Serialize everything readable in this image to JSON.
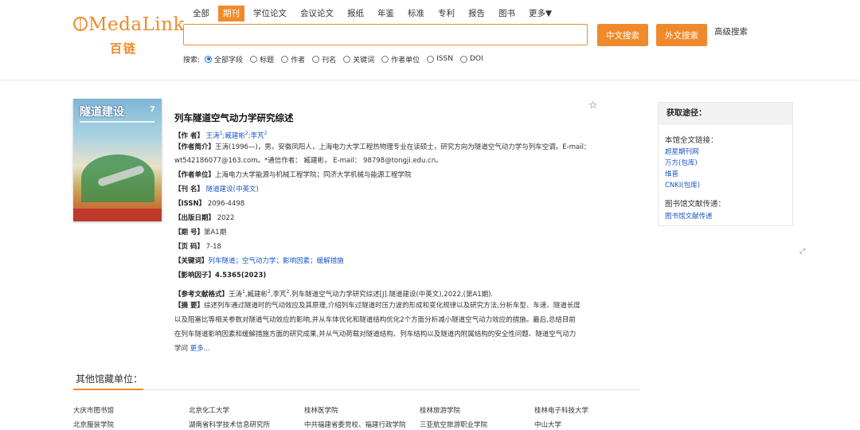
{
  "logo": {
    "en": "MedaLink",
    "cn": "百链"
  },
  "tabs": [
    {
      "label": "全部",
      "active": false
    },
    {
      "label": "期刊",
      "active": true
    },
    {
      "label": "学位论文",
      "active": false
    },
    {
      "label": "会议论文",
      "active": false
    },
    {
      "label": "报纸",
      "active": false
    },
    {
      "label": "年鉴",
      "active": false
    },
    {
      "label": "标准",
      "active": false
    },
    {
      "label": "专利",
      "active": false
    },
    {
      "label": "报告",
      "active": false
    },
    {
      "label": "图书",
      "active": false
    },
    {
      "label": "更多▼",
      "active": false
    }
  ],
  "search": {
    "value": "",
    "btn_cn": "中文搜索",
    "btn_foreign": "外文搜索",
    "advanced": "高级搜索",
    "field_label": "搜索:",
    "fields": [
      "全部字段",
      "标题",
      "作者",
      "刊名",
      "关键词",
      "作者单位",
      "ISSN",
      "DOI"
    ],
    "selected_field": "全部字段"
  },
  "cover": {
    "title": "隧道建设",
    "issue": "7"
  },
  "article": {
    "title": "列车隧道空气动力学研究综述",
    "authors_label": "【作    者】",
    "authors": [
      {
        "name": "王涛",
        "sup": "1"
      },
      {
        "name": ";臧建彬",
        "sup": "2"
      },
      {
        "name": ";李芃",
        "sup": "2"
      }
    ],
    "bio_label": "【作者简介】",
    "bio": "王涛(1996—)，男，安徽凤阳人，上海电力大学工程热物理专业在读硕士，研究方向为隧道空气动力学与列车空调。E-mail： wt542186077@163.com。*通信作者： 臧建彬， E-mail： 98798@tongji.edu.cn。",
    "affil_label": "【作者单位】",
    "affil": "上海电力大学能源与机械工程学院；同济大学机械与能源工程学院",
    "journal_label": "【刊    名】",
    "journal": "隧道建设(中英文)",
    "issn_label": "【ISSN】",
    "issn": "2096-4498",
    "date_label": "【出版日期】",
    "date": "2022",
    "issue_label": "【期    号】",
    "issue": "第A1期",
    "pages_label": "【页    码】",
    "pages": "7-18",
    "keywords_label": "【关键词】",
    "keywords": [
      "列车隧道",
      "空气动力学",
      "影响因素",
      "缓解措施"
    ],
    "if_label": "【影响因子】",
    "if_value": "4.5365(2023)",
    "ref_label": "【参考文献格式】",
    "ref_a1": "王涛",
    "ref_s1": "1",
    "ref_a2": ",臧建彬",
    "ref_s2": "2",
    "ref_a3": ",李芃",
    "ref_s3": "2",
    "ref_tail": ".列车隧道空气动力学研究综述[J].隧道建设(中英文),2022,(第A1期).",
    "abstract_label": "【摘    要】",
    "abstract_l1": "综述列车通过隧道时的气动效应及其原理,介绍列车过隧道时压力波的形成和变化规律以及研究方法,分析车型、车速、隧道长度",
    "abstract_l2": "以及阻塞比等相关参数对隧道气动效应的影响,并从车体优化和隧道结构优化2个方面分析减小隧道空气动力效应的措施。最后,总结目前",
    "abstract_l3": "在列车隧道影响因素和缓解措施方面的研究成果,并从气动荷载对隧道结构、列车结构以及隧道内附属结构的安全性问题、隧道空气动力",
    "abstract_l4": "学问",
    "more": "更多..."
  },
  "panel": {
    "title": "获取途径：",
    "fulltext_label": "本馆全文链接：",
    "fulltext_links": [
      "超星期刊网",
      "万方(包库)",
      "维普",
      "CNKI(包库)"
    ],
    "delivery_label": "图书馆文献传递：",
    "delivery_link": "图书馆文献传递"
  },
  "other": {
    "title": "其他馆藏单位：",
    "libraries": [
      "大庆市图书馆",
      "北京化工大学",
      "桂林医学院",
      "桂林旅游学院",
      "桂林电子科技大学",
      "北京服装学院",
      "湖南省科学技术信息研究所",
      "中共福建省委党校、福建行政学院",
      "三亚航空旅游职业学院",
      "中山大学"
    ]
  },
  "colors": {
    "accent": "#ef8a2c",
    "link": "#1a56c7"
  }
}
